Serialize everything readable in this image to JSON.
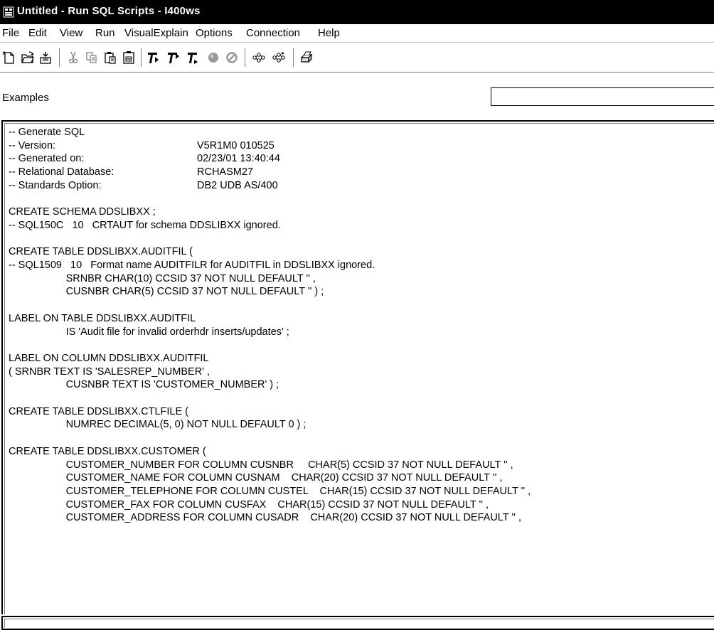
{
  "window": {
    "title": "Untitled - Run SQL Scripts - I400ws"
  },
  "menu": {
    "items": [
      {
        "label": "File"
      },
      {
        "label": "Edit"
      },
      {
        "label": "View"
      },
      {
        "label": "Run"
      },
      {
        "label": "VisualExplain"
      },
      {
        "label": "Options"
      },
      {
        "label": "Connection"
      },
      {
        "label": "Help"
      }
    ]
  },
  "toolbar": {
    "buttons": [
      {
        "icon": "new-document-icon"
      },
      {
        "icon": "open-folder-icon"
      },
      {
        "icon": "save-icon"
      },
      {
        "icon": "cut-icon"
      },
      {
        "icon": "copy-icon"
      },
      {
        "icon": "paste-icon"
      },
      {
        "icon": "paste-special-icon"
      },
      {
        "icon": "run-all-icon"
      },
      {
        "icon": "run-from-selected-icon"
      },
      {
        "icon": "run-selected-icon"
      },
      {
        "icon": "stop-icon"
      },
      {
        "icon": "cancel-icon"
      },
      {
        "icon": "visual-explain-icon"
      },
      {
        "icon": "run-and-explain-icon"
      },
      {
        "icon": "print-icon"
      }
    ]
  },
  "examples": {
    "label": "Examples",
    "value": ""
  },
  "script": {
    "lines": [
      {
        "text": "-- Generate SQL",
        "col2": ""
      },
      {
        "text": "-- Version:",
        "col2": "V5R1M0 010525"
      },
      {
        "text": "-- Generated on:",
        "col2": "02/23/01 13:40:44"
      },
      {
        "text": "-- Relational Database:",
        "col2": "RCHASM27"
      },
      {
        "text": "-- Standards Option:",
        "col2": "DB2 UDB AS/400"
      },
      {
        "text": "",
        "col2": ""
      },
      {
        "text": "CREATE SCHEMA DDSLIBXX ;",
        "col2": ""
      },
      {
        "text": "-- SQL150C   10   CRTAUT for schema DDSLIBXX ignored.",
        "col2": ""
      },
      {
        "text": "",
        "col2": ""
      },
      {
        "text": "CREATE TABLE DDSLIBXX.AUDITFIL (",
        "col2": ""
      },
      {
        "text": "-- SQL1509   10   Format name AUDITFILR for AUDITFIL in DDSLIBXX ignored.",
        "col2": ""
      },
      {
        "text": "                    SRNBR CHAR(10) CCSID 37 NOT NULL DEFAULT '' ,",
        "col2": ""
      },
      {
        "text": "                    CUSNBR CHAR(5) CCSID 37 NOT NULL DEFAULT '' ) ;",
        "col2": ""
      },
      {
        "text": "",
        "col2": ""
      },
      {
        "text": "LABEL ON TABLE DDSLIBXX.AUDITFIL",
        "col2": ""
      },
      {
        "text": "                    IS 'Audit file for invalid orderhdr inserts/updates' ;",
        "col2": ""
      },
      {
        "text": "",
        "col2": ""
      },
      {
        "text": "LABEL ON COLUMN DDSLIBXX.AUDITFIL",
        "col2": ""
      },
      {
        "text": "( SRNBR TEXT IS 'SALESREP_NUMBER' ,",
        "col2": ""
      },
      {
        "text": "                    CUSNBR TEXT IS 'CUSTOMER_NUMBER' ) ;",
        "col2": ""
      },
      {
        "text": "",
        "col2": ""
      },
      {
        "text": "CREATE TABLE DDSLIBXX.CTLFILE (",
        "col2": ""
      },
      {
        "text": "                    NUMREC DECIMAL(5, 0) NOT NULL DEFAULT 0 ) ;",
        "col2": ""
      },
      {
        "text": "",
        "col2": ""
      },
      {
        "text": "CREATE TABLE DDSLIBXX.CUSTOMER (",
        "col2": ""
      },
      {
        "text": "                    CUSTOMER_NUMBER FOR COLUMN CUSNBR     CHAR(5) CCSID 37 NOT NULL DEFAULT '' ,",
        "col2": ""
      },
      {
        "text": "                    CUSTOMER_NAME FOR COLUMN CUSNAM    CHAR(20) CCSID 37 NOT NULL DEFAULT '' ,",
        "col2": ""
      },
      {
        "text": "                    CUSTOMER_TELEPHONE FOR COLUMN CUSTEL    CHAR(15) CCSID 37 NOT NULL DEFAULT '' ,",
        "col2": ""
      },
      {
        "text": "                    CUSTOMER_FAX FOR COLUMN CUSFAX    CHAR(15) CCSID 37 NOT NULL DEFAULT '' ,",
        "col2": ""
      },
      {
        "text": "                    CUSTOMER_ADDRESS FOR COLUMN CUSADR    CHAR(20) CCSID 37 NOT NULL DEFAULT '' ,",
        "col2": ""
      }
    ]
  }
}
